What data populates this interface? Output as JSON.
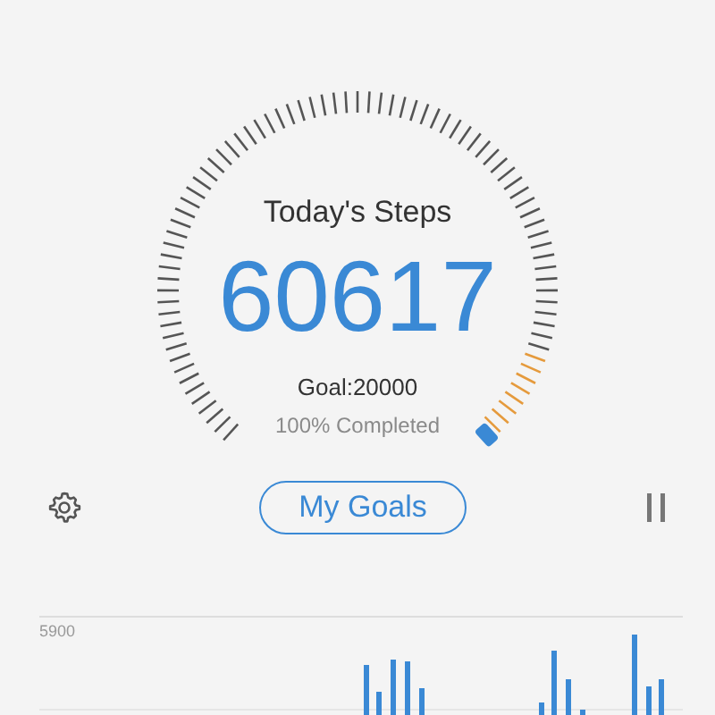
{
  "gauge": {
    "title": "Today's Steps",
    "steps": "60617",
    "goal": "Goal:20000",
    "completion": "100% Completed"
  },
  "controls": {
    "goals_button": "My Goals"
  },
  "chart": {
    "top_label": "5900"
  }
}
